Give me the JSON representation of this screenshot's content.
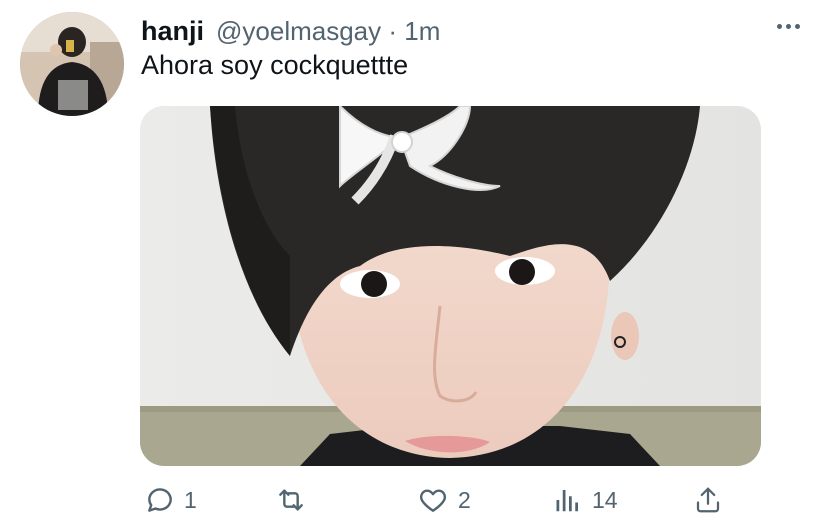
{
  "tweet": {
    "author_name": "hanji",
    "handle_time": "@yoelmasgay · 1m",
    "text": "Ahora soy cockquettte"
  },
  "actions": {
    "reply_count": "1",
    "retweet_count": "",
    "like_count": "2",
    "views_count": "14"
  },
  "icons": {
    "more": "more-horizontal-icon",
    "reply": "reply-icon",
    "retweet": "retweet-icon",
    "like": "heart-icon",
    "views": "views-icon",
    "share": "share-icon"
  },
  "colors": {
    "text_primary": "#0f1419",
    "text_secondary": "#536471"
  }
}
